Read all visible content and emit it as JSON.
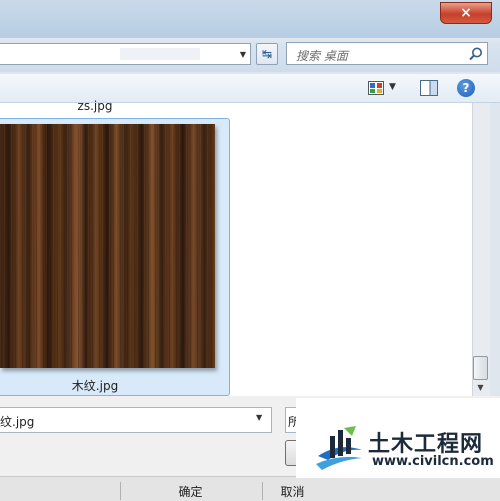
{
  "window": {
    "close_label": "×"
  },
  "address": {
    "refresh_glyph": "↹"
  },
  "search": {
    "placeholder": "搜索 桌面"
  },
  "toolbar": {
    "help_label": "?"
  },
  "files": [
    {
      "name": "zs.jpg"
    },
    {
      "name": "木纹.jpg",
      "selected": true
    }
  ],
  "bottom": {
    "filename_value": "纹.jpg",
    "filter_value": "所",
    "ok_label": "确定",
    "cancel_label": "取消"
  },
  "watermark": {
    "title": "土木工程网",
    "url": "www.civilcn.com"
  },
  "colors": {
    "selection_bg": "#d8e9f9",
    "selection_border": "#7fb2e6",
    "wood_dark": "#3d2414",
    "wood_light": "#7a4b28"
  }
}
